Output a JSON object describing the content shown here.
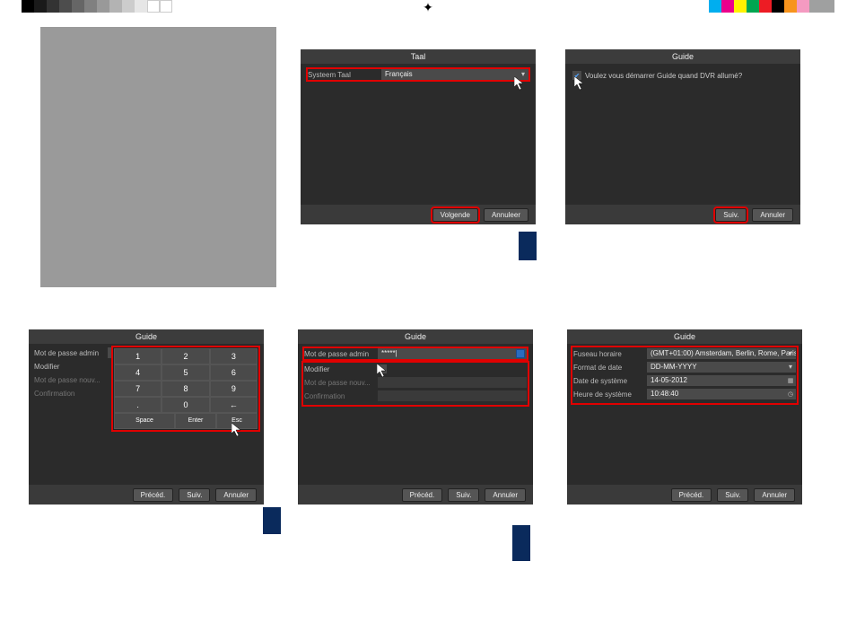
{
  "colorbar_left": [
    "#000000",
    "#1a1a1a",
    "#333333",
    "#4d4d4d",
    "#666666",
    "#808080",
    "#999999",
    "#b3b3b3",
    "#cccccc",
    "#e6e6e6",
    "#ffffff",
    "#ffffff"
  ],
  "colorbar_right": [
    "#00aeef",
    "#ec008c",
    "#fff200",
    "#00a651",
    "#ed1c24",
    "#000000",
    "#f7941d",
    "#f49ac1",
    "#9fa0a0",
    "#9fa0a0"
  ],
  "screens": {
    "s1": {
      "title": "Taal",
      "label": "Systeem Taal",
      "value": "Français",
      "next": "Volgende",
      "cancel": "Annuleer"
    },
    "s2": {
      "title": "Guide",
      "checkbox_text": "Voulez vous démarrer Guide quand DVR allumé?",
      "next": "Suiv.",
      "cancel": "Annuler"
    },
    "s3": {
      "title": "Guide",
      "r1": "Mot de passe admin",
      "r1v": "*****",
      "r2": "Modifier",
      "r3": "Mot de passe nouv...",
      "r4": "Confirmation",
      "prev": "Précéd.",
      "next": "Suiv.",
      "cancel": "Annuler",
      "keys": [
        [
          "1",
          "2",
          "3"
        ],
        [
          "4",
          "5",
          "6"
        ],
        [
          "7",
          "8",
          "9"
        ],
        [
          ".",
          "0",
          "←"
        ]
      ],
      "space": "Space",
      "enter": "Enter",
      "esc": "Esc"
    },
    "s4": {
      "title": "Guide",
      "r1": "Mot de passe admin",
      "r1v": "*****|",
      "r2": "Modifier",
      "r3": "Mot de passe nouv...",
      "r4": "Confirmation",
      "prev": "Précéd.",
      "next": "Suiv.",
      "cancel": "Annuler"
    },
    "s5": {
      "title": "Guide",
      "r1": "Fuseau horaire",
      "r1v": "(GMT+01:00) Amsterdam, Berlin, Rome, Paris",
      "r2": "Format de date",
      "r2v": "DD-MM-YYYY",
      "r3": "Date de système",
      "r3v": "14-05-2012",
      "r4": "Heure de système",
      "r4v": "10:48:40",
      "prev": "Précéd.",
      "next": "Suiv.",
      "cancel": "Annuler"
    }
  }
}
